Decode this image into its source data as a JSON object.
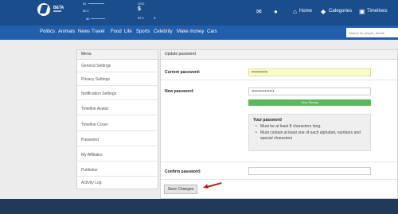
{
  "header": {
    "logo_text": "BETA",
    "stats": {
      "s1_label": "$1",
      "s2_label": "$0.1",
      "s3_label": "$0",
      "usd_label": "USD",
      "usd_value": "$",
      "btc_label": "BTC",
      "btc_value": "$"
    },
    "nav": {
      "home": "Home",
      "categories": "Categories",
      "timelines": "Timelines"
    }
  },
  "categories": [
    "Politics",
    "Animals",
    "News",
    "Travel",
    "Food",
    "Life",
    "Sports",
    "Celebrity",
    "Make money",
    "Cars"
  ],
  "search": {
    "placeholder": "Search for people, trends"
  },
  "menu": {
    "title": "Menu",
    "items": [
      "General Settings",
      "Privacy Settings",
      "Notification Settings",
      "Timeline Avatar",
      "Timeline Cover",
      "Password",
      "My Affiliates",
      "Publisher",
      "Activity Log"
    ]
  },
  "panel": {
    "title": "Update password",
    "current_label": "Current password:",
    "current_value": "••••••••••",
    "new_label": "New password:",
    "new_value": "••••••••••••••",
    "strength_text": "Very Strong",
    "strength_fraction": 1.0,
    "requirements_title": "Your password",
    "requirements": [
      "Must be at least 8 characters long.",
      "Must contain at least one of each alphabet, numbers and special characters"
    ],
    "confirm_label": "Confirm password:",
    "confirm_value": "",
    "save_label": "Save Changes"
  },
  "colors": {
    "topbar": "#1a4d8b",
    "catbar": "#215eab",
    "strength": "#5cb85c",
    "annotation_arrow": "#b51d1d",
    "footer": "#223a5a"
  }
}
